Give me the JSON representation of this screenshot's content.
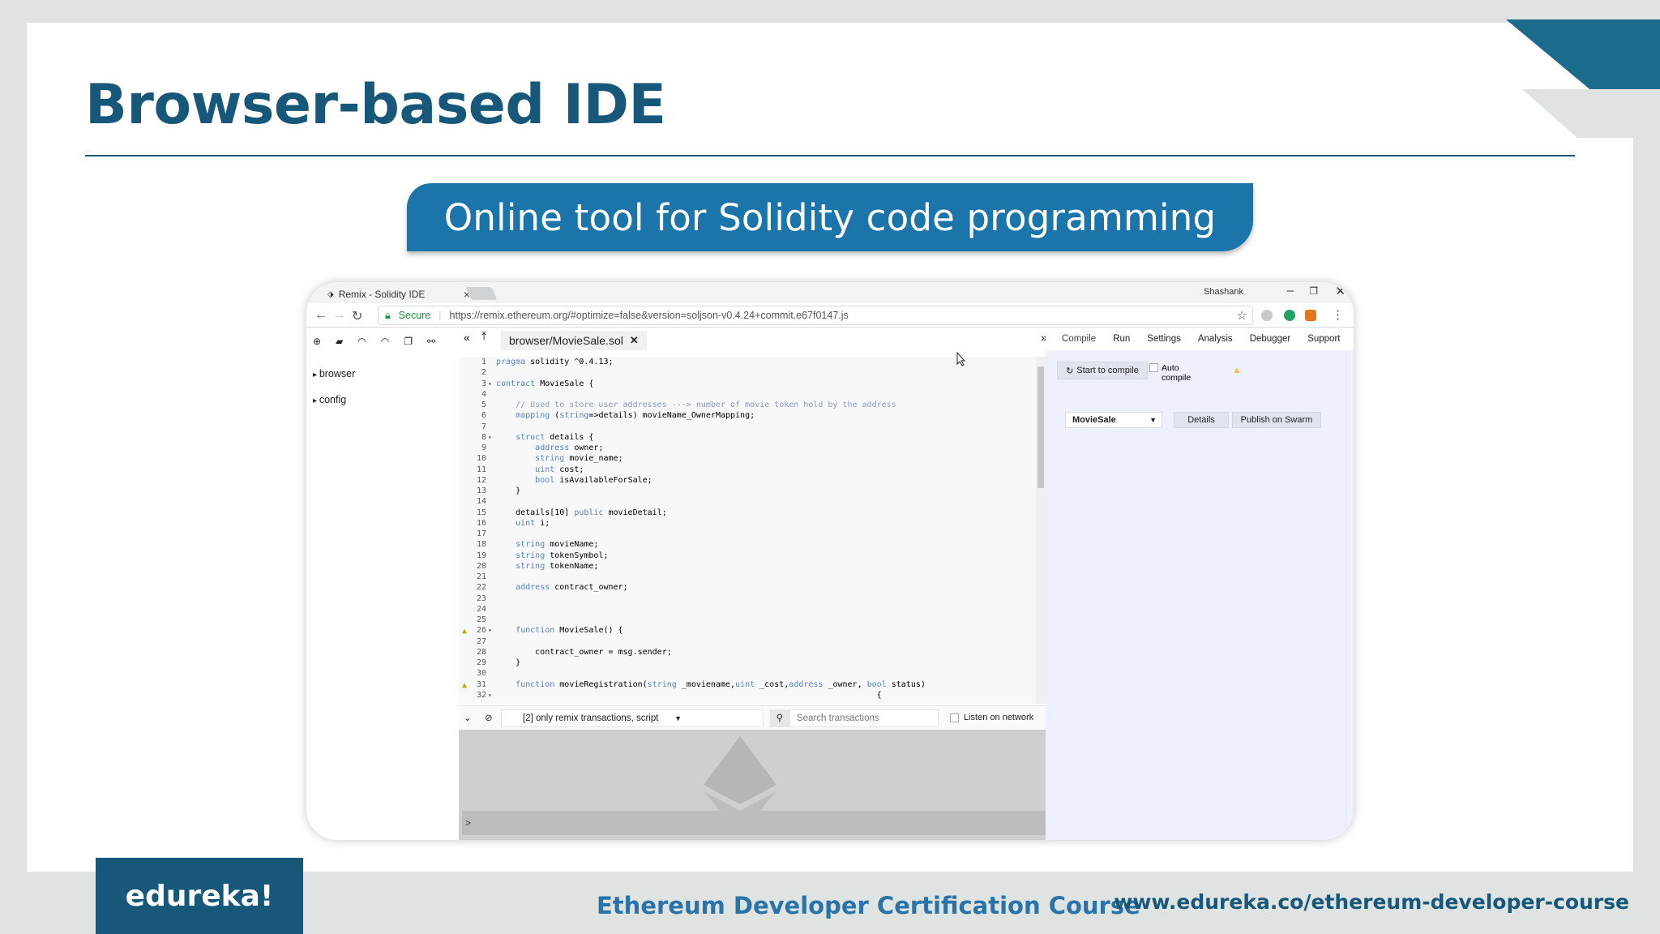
{
  "slide": {
    "title": "Browser-based IDE",
    "banner": "Online tool for Solidity code programming"
  },
  "browser": {
    "tab_title": "Remix - Solidity IDE",
    "tab_close": "×",
    "user_name": "Shashank",
    "secure_label": "Secure",
    "url": "https://remix.ethereum.org/#optimize=false&version=soljson-v0.4.24+commit.e67f0147.js"
  },
  "file_panel": {
    "items": [
      "browser",
      "config"
    ]
  },
  "editor": {
    "file_tab": "browser/MovieSale.sol",
    "lines": [
      {
        "n": "1",
        "text": "pragma solidity ^0.4.13;"
      },
      {
        "n": "2",
        "text": ""
      },
      {
        "n": "3",
        "text": "contract MovieSale {",
        "fold": true
      },
      {
        "n": "4",
        "text": ""
      },
      {
        "n": "5",
        "text": "    // Used to store user addresses ---> number of movie token hold by the address",
        "cls": "cm"
      },
      {
        "n": "6",
        "text": "    mapping (string=>details) movieName_OwnerMapping;"
      },
      {
        "n": "7",
        "text": ""
      },
      {
        "n": "8",
        "text": "    struct details {",
        "fold": true
      },
      {
        "n": "9",
        "text": "        address owner;"
      },
      {
        "n": "10",
        "text": "        string movie_name;"
      },
      {
        "n": "11",
        "text": "        uint cost;"
      },
      {
        "n": "12",
        "text": "        bool isAvailableForSale;"
      },
      {
        "n": "13",
        "text": "    }"
      },
      {
        "n": "14",
        "text": ""
      },
      {
        "n": "15",
        "text": "    details[10] public movieDetail;"
      },
      {
        "n": "16",
        "text": "    uint i;"
      },
      {
        "n": "17",
        "text": ""
      },
      {
        "n": "18",
        "text": "    string movieName;"
      },
      {
        "n": "19",
        "text": "    string tokenSymbol;"
      },
      {
        "n": "20",
        "text": "    string tokenName;"
      },
      {
        "n": "21",
        "text": ""
      },
      {
        "n": "22",
        "text": "    address contract_owner;"
      },
      {
        "n": "23",
        "text": ""
      },
      {
        "n": "24",
        "text": ""
      },
      {
        "n": "25",
        "text": ""
      },
      {
        "n": "26",
        "text": "    function MovieSale() {",
        "fold": true,
        "warn": true
      },
      {
        "n": "27",
        "text": ""
      },
      {
        "n": "28",
        "text": "        contract_owner = msg.sender;"
      },
      {
        "n": "29",
        "text": "    }"
      },
      {
        "n": "30",
        "text": ""
      },
      {
        "n": "31",
        "text": "    function movieRegistration(string _moviename,uint _cost,address _owner, bool status)",
        "warn": true
      },
      {
        "n": "32",
        "text": "                                                                              {",
        "fold": true
      }
    ]
  },
  "terminal": {
    "filter": "[2] only remix transactions, script",
    "search_placeholder": "Search transactions",
    "listen_label": "Listen on network",
    "prompt": ">"
  },
  "right_panel": {
    "tabs": [
      "Compile",
      "Run",
      "Settings",
      "Analysis",
      "Debugger",
      "Support"
    ],
    "start_compile": "Start to compile",
    "auto_compile": "Auto compile",
    "contract": "MovieSale",
    "details": "Details",
    "publish": "Publish on Swarm"
  },
  "footer": {
    "logo": "edureka!",
    "course": "Ethereum Developer Certification Course",
    "site": "www.edureka.co/ethereum-developer-course"
  },
  "colors": {
    "brand": "#17587a",
    "banner": "#1b75aa"
  }
}
